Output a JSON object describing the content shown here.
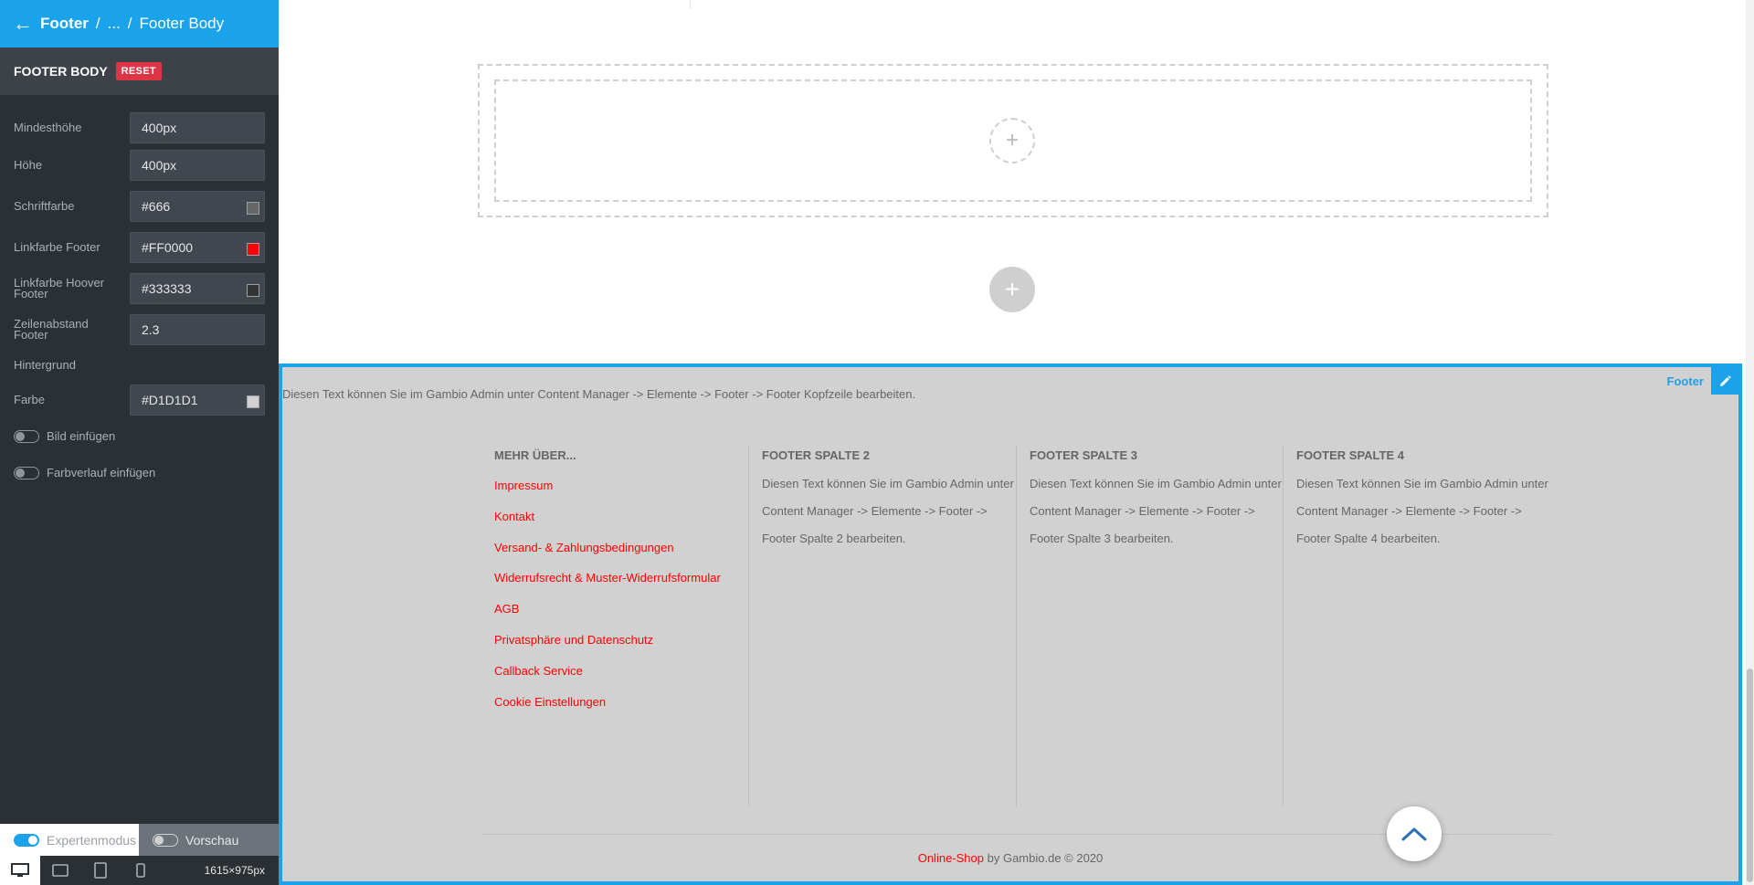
{
  "breadcrumb": {
    "root": "Footer",
    "sep1": "/",
    "ellipsis": "...",
    "sep2": "/",
    "current": "Footer Body"
  },
  "section": {
    "title": "FOOTER BODY",
    "reset_label": "RESET"
  },
  "fields": {
    "min_height": {
      "label": "Mindesthöhe",
      "value": "400px"
    },
    "height": {
      "label": "Höhe",
      "value": "400px"
    },
    "font_color": {
      "label": "Schriftfarbe",
      "value": "#666",
      "swatch": "#666666"
    },
    "link_color": {
      "label": "Linkfarbe Footer",
      "value": "#FF0000",
      "swatch": "#FF0000"
    },
    "link_hover": {
      "label": "Linkfarbe Hoover Footer",
      "value": "#333333",
      "swatch": "#333333"
    },
    "line_height": {
      "label": "Zeilenabstand Footer",
      "value": "2.3"
    },
    "background_label": "Hintergrund",
    "bg_color": {
      "label": "Farbe",
      "value": "#D1D1D1",
      "swatch": "#D1D1D1"
    }
  },
  "toggles": {
    "image": "Bild einfügen",
    "gradient": "Farbverlauf einfügen"
  },
  "modes": {
    "expert": "Expertenmodus",
    "preview": "Vorschau"
  },
  "devices": {
    "dims": "1615×975px"
  },
  "footer": {
    "badge": "Footer",
    "top_text": "Diesen Text können Sie im Gambio Admin unter Content Manager -> Elemente -> Footer -> Footer Kopfzeile bearbeiten.",
    "col1": {
      "title": "MEHR ÜBER...",
      "links": [
        "Impressum",
        "Kontakt",
        "Versand- & Zahlungsbedingungen",
        "Widerrufsrecht & Muster-Widerrufsformular",
        "AGB",
        "Privatsphäre und Datenschutz",
        "Callback Service",
        "Cookie Einstellungen"
      ]
    },
    "col2": {
      "title": "FOOTER SPALTE 2",
      "text": "Diesen Text können Sie im Gambio Admin unter Content Manager -> Elemente -> Footer -> Footer Spalte 2 bearbeiten."
    },
    "col3": {
      "title": "FOOTER SPALTE 3",
      "text": "Diesen Text können Sie im Gambio Admin unter Content Manager -> Elemente -> Footer -> Footer Spalte 3 bearbeiten."
    },
    "col4": {
      "title": "FOOTER SPALTE 4",
      "text": "Diesen Text können Sie im Gambio Admin unter Content Manager -> Elemente -> Footer -> Footer Spalte 4 bearbeiten."
    },
    "copyright": {
      "shop": "Online-Shop",
      "rest": " by Gambio.de © 2020"
    }
  },
  "icons": {
    "back": "arrow-left-icon",
    "plus": "plus-icon",
    "edit": "pencil-icon",
    "scroll_top": "chevron-up-icon"
  },
  "colors": {
    "accent": "#1aa3eb",
    "danger": "#dc3545",
    "sidebar": "#2b3035"
  }
}
